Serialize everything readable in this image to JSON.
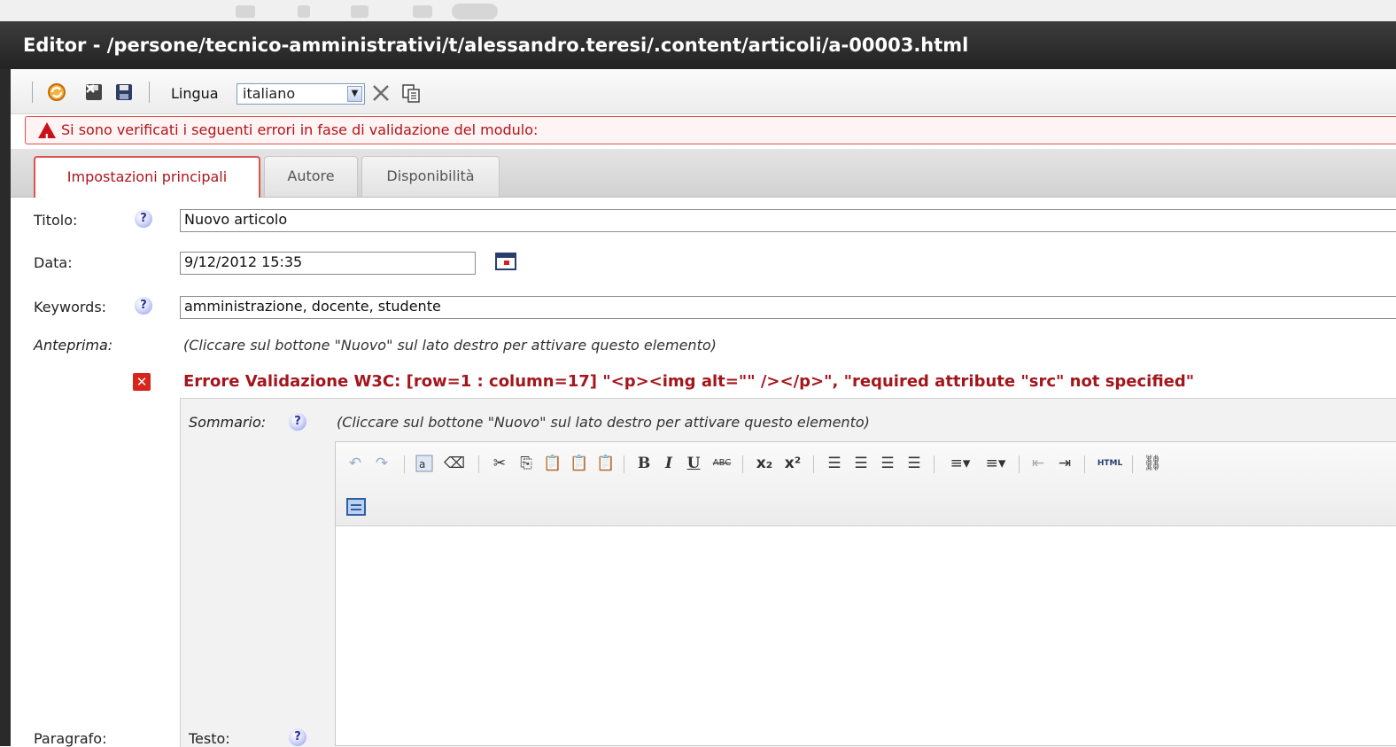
{
  "window": {
    "title": "Editor - /persone/tecnico-amministrativi/t/alessandro.teresi/.content/articoli/a-00003.html"
  },
  "toolbar": {
    "buttons": [
      {
        "name": "refresh-icon",
        "color": "#e8a020"
      },
      {
        "name": "save-exit-icon",
        "color": "#2b2b2b"
      },
      {
        "name": "save-icon",
        "color": "#2b3c5c"
      }
    ],
    "language_label": "Lingua",
    "language_value": "italiano",
    "delete_icon": "close-icon",
    "copy_icon": "copy-icon"
  },
  "validation": {
    "banner_text": "Si sono verificati i seguenti errori in fase di validazione del modulo:",
    "error_color": "#b1141b"
  },
  "tabs": [
    {
      "label": "Impostazioni principali",
      "active": true
    },
    {
      "label": "Autore",
      "active": false
    },
    {
      "label": "Disponibilità",
      "active": false
    }
  ],
  "form": {
    "title_label": "Titolo:",
    "title_value": "Nuovo articolo",
    "date_label": "Data:",
    "date_value": "9/12/2012 15:35",
    "keywords_label": "Keywords:",
    "keywords_value": "amministrazione, docente, studente",
    "preview_label": "Anteprima:",
    "preview_hint": "(Cliccare sul bottone \"Nuovo\" sul lato destro per attivare questo elemento)",
    "w3c_error": "Errore Validazione W3C: [row=1 : column=17] \"<p><img alt=\"\" /></p>\", \"required attribute \"src\" not specified\"",
    "summary_label": "Sommario:",
    "summary_hint": "(Cliccare sul bottone \"Nuovo\" sul lato destro per attivare questo elemento)",
    "paragraph_label": "Paragrafo:",
    "text_label": "Testo:",
    "help_glyph": "?"
  },
  "editor_toolbar": {
    "bold": "B",
    "italic": "I",
    "underline": "U",
    "strike": "ABC",
    "subscript": "x₂",
    "superscript": "x²",
    "html": "HTML"
  }
}
